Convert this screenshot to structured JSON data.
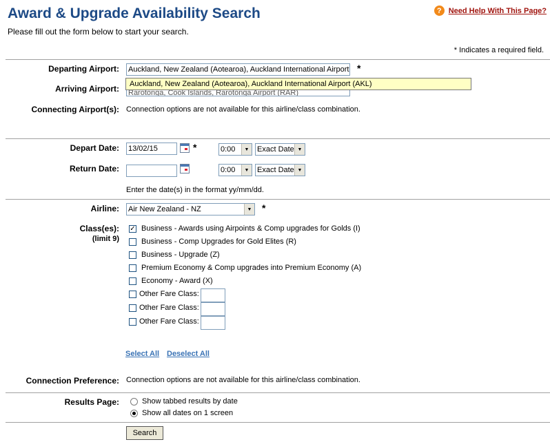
{
  "header": {
    "title": "Award & Upgrade Availability Search",
    "subtitle": "Please fill out the form below to start your search.",
    "help_link": "Need Help With This Page?",
    "required_note": "* Indicates a required field."
  },
  "airports": {
    "departing_label": "Departing Airport:",
    "departing_value": "Auckland, New Zealand (Aotearoa), Auckland International Airport (AKL)",
    "autocomplete_suggestion": "Auckland, New Zealand (Aotearoa), Auckland International Airport (AKL)",
    "arriving_label": "Arriving Airport:",
    "arriving_value": "Rarotonga, Cook Islands, Rarotonga Airport (RAR)",
    "connecting_label": "Connecting Airport(s):",
    "connecting_note": "Connection options are not available for this airline/class combination."
  },
  "dates": {
    "depart_label": "Depart Date:",
    "depart_value": "13/02/15",
    "depart_time": "0:00",
    "depart_flex": "Exact Date",
    "return_label": "Return Date:",
    "return_value": "",
    "return_time": "0:00",
    "return_flex": "Exact Date",
    "format_hint": "Enter the date(s) in the format yy/mm/dd."
  },
  "airline": {
    "label": "Airline:",
    "value": "Air New Zealand - NZ"
  },
  "classes": {
    "label": "Class(es):",
    "limit": "(limit 9)",
    "options": [
      {
        "label": "Business - Awards using Airpoints & Comp upgrades for Golds (I)",
        "checked": true
      },
      {
        "label": "Business - Comp Upgrades for Gold Elites (R)",
        "checked": false
      },
      {
        "label": "Business - Upgrade (Z)",
        "checked": false
      },
      {
        "label": "Premium Economy & Comp upgrades into Premium Economy (A)",
        "checked": false
      },
      {
        "label": "Economy - Award (X)",
        "checked": false
      }
    ],
    "other_label": "Other Fare Class:",
    "select_all": "Select All",
    "deselect_all": "Deselect All"
  },
  "connection": {
    "label": "Connection Preference:",
    "note": "Connection options are not available for this airline/class combination."
  },
  "results": {
    "label": "Results Page:",
    "option_tabbed": "Show tabbed results by date",
    "option_all": "Show all dates on 1 screen",
    "selected": "all"
  },
  "search_button": "Search"
}
